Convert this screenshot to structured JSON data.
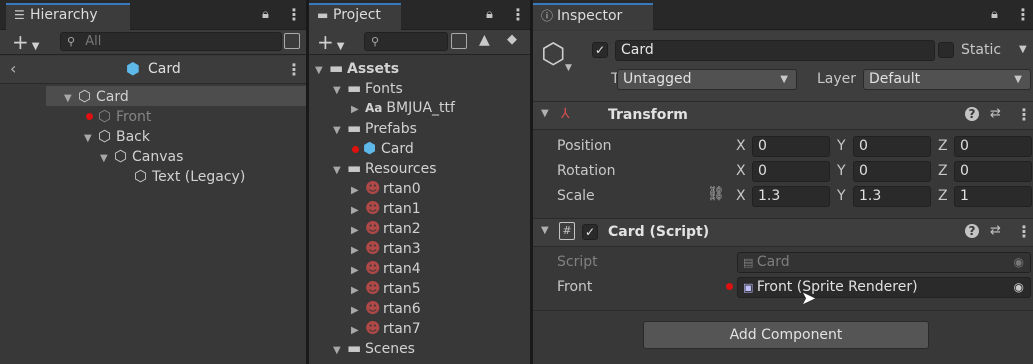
{
  "hierarchy": {
    "tab_label": "Hierarchy",
    "search_placeholder": "All",
    "scene_title": "Card",
    "tree": [
      {
        "label": "Card"
      },
      {
        "label": "Front"
      },
      {
        "label": "Back"
      },
      {
        "label": "Canvas"
      },
      {
        "label": "Text (Legacy)"
      }
    ]
  },
  "project": {
    "tab_label": "Project",
    "tree": [
      {
        "label": "Assets"
      },
      {
        "label": "Fonts"
      },
      {
        "label": "BMJUA_ttf",
        "icon_text": "Aa"
      },
      {
        "label": "Prefabs"
      },
      {
        "label": "Card"
      },
      {
        "label": "Resources"
      },
      {
        "label": "rtan0"
      },
      {
        "label": "rtan1"
      },
      {
        "label": "rtan2"
      },
      {
        "label": "rtan3"
      },
      {
        "label": "rtan4"
      },
      {
        "label": "rtan5"
      },
      {
        "label": "rtan6"
      },
      {
        "label": "rtan7"
      },
      {
        "label": "Scenes"
      }
    ]
  },
  "inspector": {
    "tab_label": "Inspector",
    "object_name": "Card",
    "static_label": "Static",
    "tag_label": "Tag",
    "tag_value": "Untagged",
    "layer_label": "Layer",
    "layer_value": "Default",
    "transform": {
      "title": "Transform",
      "axis_x": "X",
      "axis_y": "Y",
      "axis_z": "Z",
      "position_label": "Position",
      "position": [
        "0",
        "0",
        "0"
      ],
      "rotation_label": "Rotation",
      "rotation": [
        "0",
        "0",
        "0"
      ],
      "scale_label": "Scale",
      "scale": [
        "1.3",
        "1.3",
        "1"
      ]
    },
    "script_component": {
      "title": "Card (Script)",
      "script_label": "Script",
      "script_value": "Card",
      "front_label": "Front",
      "front_value": "Front (Sprite Renderer)"
    },
    "add_component_label": "Add Component"
  },
  "colors": {
    "accent": "#3a79bb",
    "selection": "#4d4d4d",
    "override_dot": "#e01010",
    "panel_bg": "#383838"
  }
}
